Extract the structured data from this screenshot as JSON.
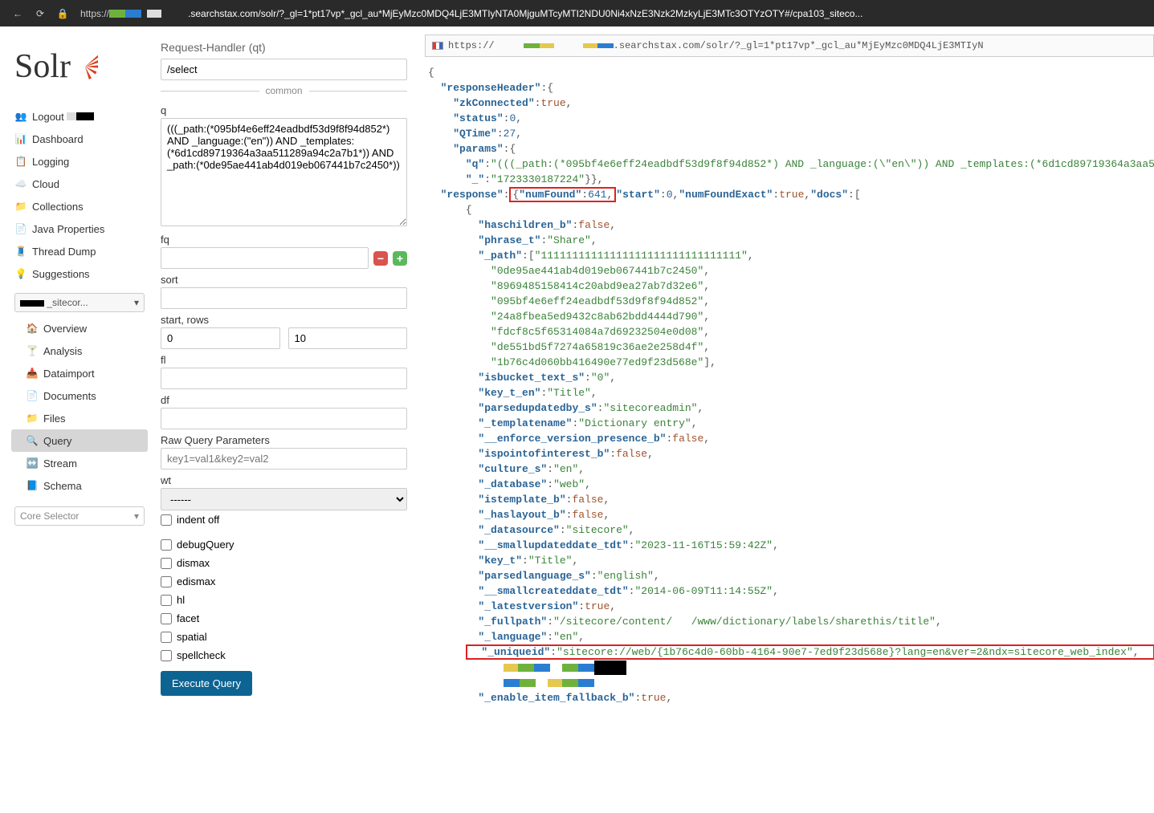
{
  "browser": {
    "url_display": ".searchstax.com/solr/?_gl=1*pt17vp*_gcl_au*MjEyMzc0MDQ4LjE3MTIyNTA0MjguMTcyMTI2NDU0Ni4xNzE3Nzk2MzkyLjE3MTc3OTYzOTY#/cpa103_siteco..."
  },
  "sidebar": {
    "logo_text": "Solr",
    "items": [
      {
        "icon": "👥",
        "label": "Logout"
      },
      {
        "icon": "📊",
        "label": "Dashboard"
      },
      {
        "icon": "📋",
        "label": "Logging"
      },
      {
        "icon": "☁️",
        "label": "Cloud"
      },
      {
        "icon": "📁",
        "label": "Collections"
      },
      {
        "icon": "📄",
        "label": "Java Properties"
      },
      {
        "icon": "🧵",
        "label": "Thread Dump"
      },
      {
        "icon": "💡",
        "label": "Suggestions"
      }
    ],
    "core_dropdown": "_sitecor...",
    "subnav": [
      {
        "icon": "🏠",
        "label": "Overview"
      },
      {
        "icon": "🍸",
        "label": "Analysis"
      },
      {
        "icon": "📥",
        "label": "Dataimport"
      },
      {
        "icon": "📄",
        "label": "Documents"
      },
      {
        "icon": "📁",
        "label": "Files"
      },
      {
        "icon": "🔍",
        "label": "Query",
        "active": true
      },
      {
        "icon": "↔️",
        "label": "Stream"
      },
      {
        "icon": "📘",
        "label": "Schema"
      }
    ],
    "core_selector": "Core Selector"
  },
  "form": {
    "qt_label": "Request-Handler (qt)",
    "qt_value": "/select",
    "common_legend": "common",
    "q_label": "q",
    "q_value": "(((_path:(*095bf4e6eff24eadbdf53d9f8f94d852*) AND _language:(\"en\")) AND _templates:(*6d1cd89719364a3aa511289a94c2a7b1*)) AND _path:(*0de95ae441ab4d019eb067441b7c2450*))",
    "fq_label": "fq",
    "sort_label": "sort",
    "startrows_label": "start, rows",
    "start_value": "0",
    "rows_value": "10",
    "fl_label": "fl",
    "df_label": "df",
    "raw_label": "Raw Query Parameters",
    "raw_placeholder": "key1=val1&key2=val2",
    "wt_label": "wt",
    "wt_value": "------",
    "indent_label": "indent off",
    "checks": [
      "debugQuery",
      "dismax",
      "edismax",
      "hl",
      "facet",
      "spatial",
      "spellcheck"
    ],
    "exec_label": "Execute Query"
  },
  "results": {
    "url": "https://          .searchstax.com/solr/?_gl=1*pt17vp*_gcl_au*MjEyMzc0MDQ4LjE3MTIyN"
  },
  "json": {
    "responseHeader": {
      "zkConnected": true,
      "status": 0,
      "QTime": 27,
      "params": {
        "q": "(((_path:(*095bf4e6eff24eadbdf53d9f8f94d852*) AND _language:(\\\"en\\\")) AND _templates:(*6d1cd89719364a3aa5",
        "_": "1723330187224"
      }
    },
    "response": {
      "numFound": 641,
      "start": 0,
      "numFoundExact": true,
      "docs0": {
        "haschildren_b": false,
        "phrase_t": "Share",
        "_path": [
          "11111111111111111111111111111111",
          "0de95ae441ab4d019eb067441b7c2450",
          "8969485158414c20abd9ea27ab7d32e6",
          "095bf4e6eff24eadbdf53d9f8f94d852",
          "24a8fbea5ed9432c8ab62bdd4444d790",
          "fdcf8c5f65314084a7d69232504e0d08",
          "de551bd5f7274a65819c36ae2e258d4f",
          "1b76c4d060bb416490e77ed9f23d568e"
        ],
        "isbucket_text_s": "0",
        "key_t_en": "Title",
        "parsedupdatedby_s": "sitecoreadmin",
        "_templatename": "Dictionary entry",
        "__enforce_version_presence_b": false,
        "ispointofinterest_b": false,
        "culture_s": "en",
        "_database": "web",
        "istemplate_b": false,
        "_haslayout_b": false,
        "_datasource": "sitecore",
        "__smallupdateddate_tdt": "2023-11-16T15:59:42Z",
        "key_t": "Title",
        "parsedlanguage_s": "english",
        "__smallcreateddate_tdt": "2014-06-09T11:14:55Z",
        "_latestversion": true,
        "_fullpath": "/sitecore/content/   /www/dictionary/labels/sharethis/title",
        "_language": "en",
        "_uniqueid": "sitecore://web/{1b76c4d0-60bb-4164-90e7-7ed9f23d568e}?lang=en&ver=2&ndx=sitecore_web_index",
        "_enable_item_fallback_b": true
      }
    }
  }
}
